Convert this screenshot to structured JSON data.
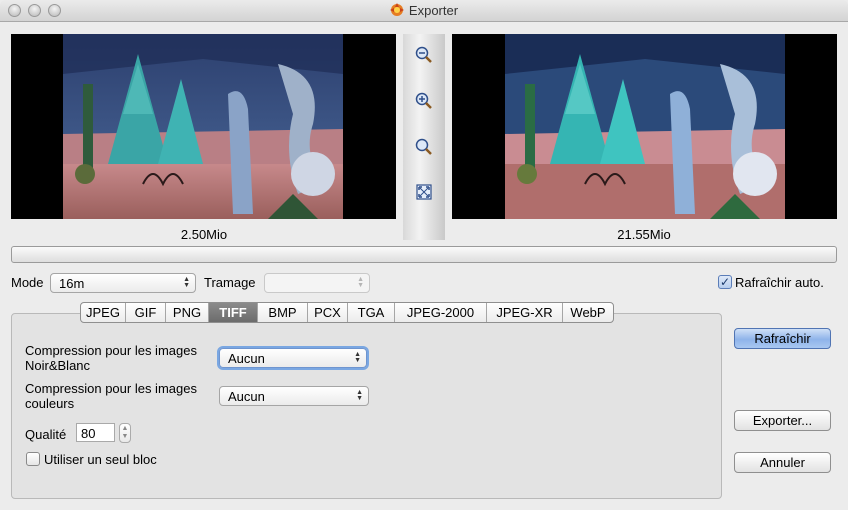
{
  "window": {
    "title": "Exporter"
  },
  "preview": {
    "left_size": "2.50Mio",
    "right_size": "21.55Mio"
  },
  "zoom_tools": [
    "zoom-out-icon",
    "zoom-in-icon",
    "zoom-actual-icon",
    "fit-screen-icon"
  ],
  "progress": {
    "fraction": 0
  },
  "mode": {
    "label": "Mode",
    "value": "16m"
  },
  "tramage": {
    "label": "Tramage",
    "value": ""
  },
  "auto_refresh": {
    "label": "Rafraîchir auto.",
    "checked": true
  },
  "tabs": [
    {
      "label": "JPEG",
      "active": false
    },
    {
      "label": "GIF",
      "active": false
    },
    {
      "label": "PNG",
      "active": false
    },
    {
      "label": "TIFF",
      "active": true
    },
    {
      "label": "BMP",
      "active": false
    },
    {
      "label": "PCX",
      "active": false
    },
    {
      "label": "TGA",
      "active": false
    },
    {
      "label": "JPEG-2000",
      "active": false
    },
    {
      "label": "JPEG-XR",
      "active": false
    },
    {
      "label": "WebP",
      "active": false
    }
  ],
  "tiff": {
    "bw_compression_label_line1": "Compression pour les images",
    "bw_compression_label_line2": "Noir&Blanc",
    "bw_compression_value": "Aucun",
    "color_compression_label_line1": "Compression pour les images",
    "color_compression_label_line2": "couleurs",
    "color_compression_value": "Aucun",
    "quality_label": "Qualité",
    "quality_value": "80",
    "single_block_label": "Utiliser un seul bloc",
    "single_block_checked": false
  },
  "buttons": {
    "refresh": "Rafraîchir",
    "export": "Exporter...",
    "cancel": "Annuler"
  },
  "colors": {
    "accent": "#7aa7e2",
    "default_button": "#8fb4ea",
    "active_tab": "#7a7a7a"
  }
}
